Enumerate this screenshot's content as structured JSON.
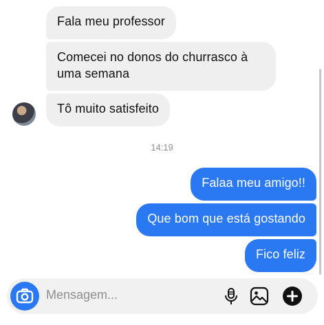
{
  "thread": {
    "incoming": [
      {
        "text": "Fala meu professor"
      },
      {
        "text": "Comecei no donos do churrasco à uma semana"
      },
      {
        "text": "Tô muito satisfeito"
      }
    ],
    "timestamp": "14:19",
    "outgoing": [
      {
        "text": "Falaa meu amigo!!"
      },
      {
        "text": "Que bom que está gostando"
      },
      {
        "text": "Fico feliz"
      }
    ]
  },
  "composer": {
    "placeholder": "Mensagem...",
    "icons": [
      "camera-icon",
      "microphone-icon",
      "gallery-icon",
      "plus-icon"
    ]
  },
  "colors": {
    "outgoing_bubble": "#2a79f2",
    "incoming_bubble": "#efefef",
    "timestamp": "#8e8e8e"
  }
}
